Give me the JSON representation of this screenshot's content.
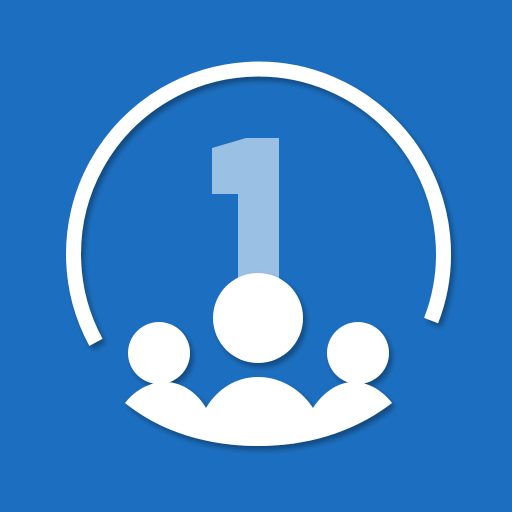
{
  "icon": {
    "name": "group-number-one-logo",
    "background_color": "#1c6fc0",
    "ring_color": "#ffffff",
    "people_color": "#ffffff",
    "numeral_color": "#9ac0e4",
    "numeral_text": "1",
    "people_count": 3
  }
}
